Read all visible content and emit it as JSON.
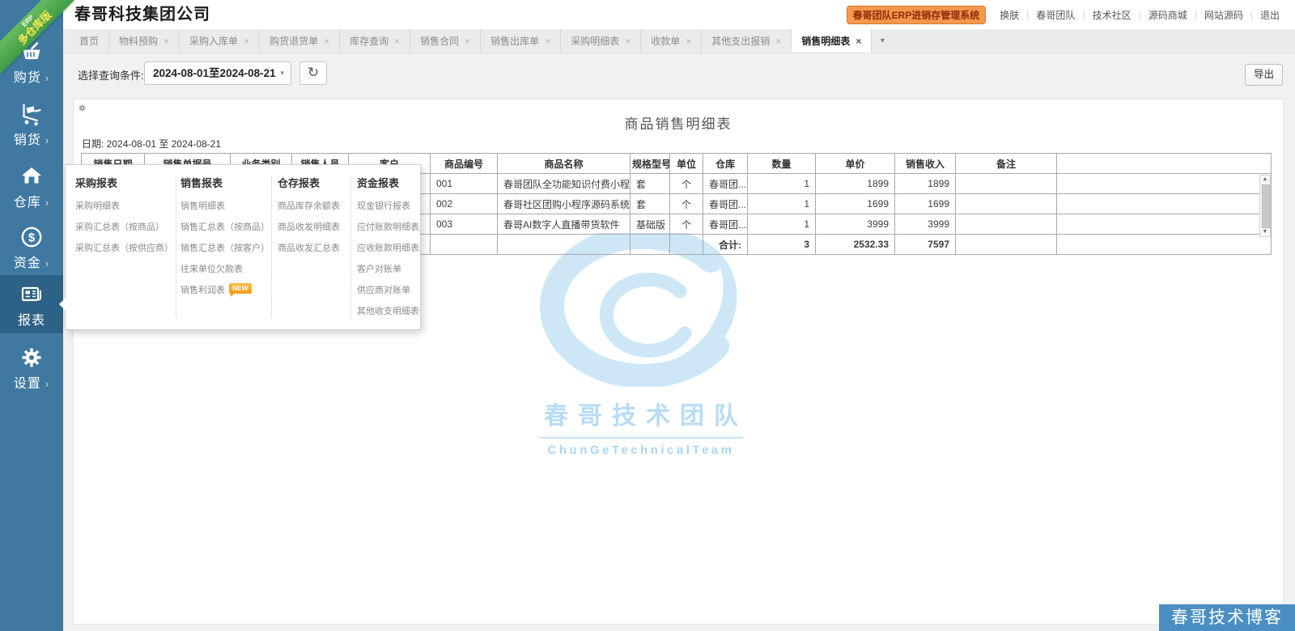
{
  "colors": {
    "sidebar": "#3f79a2",
    "sidebar_active": "#2d6286",
    "ribbon_green": "#4aa74d",
    "ribbon_text_yellow": "#ffe94e",
    "badge_orange_bg": "#f2994d",
    "badge_orange_text": "#8f2c0b",
    "watermark_blue": "#cde7f7",
    "footer_blue": "#4a8fc2",
    "new_badge_orange": "#f59d16"
  },
  "ribbon": {
    "line1": "ERP",
    "line2": "多仓库版"
  },
  "header": {
    "company": "春哥科技集团公司",
    "badge": "春哥团队ERP进销存管理系统",
    "links": [
      "换肤",
      "春哥团队",
      "技术社区",
      "源码商城",
      "网站源码",
      "退出"
    ]
  },
  "sidebar": {
    "items": [
      {
        "key": "purchase",
        "label": "购货",
        "icon": "basket-icon",
        "chevron": "›",
        "active": false
      },
      {
        "key": "sales",
        "label": "销货",
        "icon": "trolley-icon",
        "chevron": "›",
        "active": false
      },
      {
        "key": "warehouse",
        "label": "仓库",
        "icon": "warehouse-icon",
        "chevron": "›",
        "active": false
      },
      {
        "key": "funds",
        "label": "资金",
        "icon": "money-icon",
        "chevron": "›",
        "active": false
      },
      {
        "key": "reports",
        "label": "报表",
        "icon": "report-icon",
        "chevron": "",
        "active": true
      },
      {
        "key": "settings",
        "label": "设置",
        "icon": "gear-icon",
        "chevron": "›",
        "active": false
      }
    ]
  },
  "tabs": [
    {
      "label": "首页",
      "closable": false,
      "active": false
    },
    {
      "label": "物料预购",
      "closable": true,
      "active": false
    },
    {
      "label": "采购入库单",
      "closable": true,
      "active": false
    },
    {
      "label": "购货退货单",
      "closable": true,
      "active": false
    },
    {
      "label": "库存查询",
      "closable": true,
      "active": false
    },
    {
      "label": "销售合同",
      "closable": true,
      "active": false
    },
    {
      "label": "销售出库单",
      "closable": true,
      "active": false
    },
    {
      "label": "采购明细表",
      "closable": true,
      "active": false
    },
    {
      "label": "收款单",
      "closable": true,
      "active": false
    },
    {
      "label": "其他支出报销",
      "closable": true,
      "active": false
    },
    {
      "label": "销售明细表",
      "closable": true,
      "active": true
    }
  ],
  "toolbar": {
    "query_label": "选择查询条件:",
    "date_range": "2024-08-01至2024-08-21",
    "export_label": "导出"
  },
  "report": {
    "title": "商品销售明细表",
    "date_line": "日期: 2024-08-01 至 2024-08-21"
  },
  "table": {
    "headers": [
      "销售日期",
      "销售单据号",
      "业务类别",
      "销售人员",
      "客户",
      "商品编号",
      "商品名称",
      "规格型号",
      "单位",
      "仓库",
      "数量",
      "单价",
      "销售收入",
      "备注",
      ""
    ],
    "rows": [
      [
        "",
        "",
        "",
        "",
        "",
        "001",
        "春哥团队全功能知识付费小程序源...",
        "套",
        "个",
        "春哥团...",
        "1",
        "1899",
        "1899",
        "",
        ""
      ],
      [
        "",
        "",
        "",
        "",
        "",
        "002",
        "春哥社区团购小程序源码系统至尊版",
        "套",
        "个",
        "春哥团...",
        "1",
        "1699",
        "1699",
        "",
        ""
      ],
      [
        "",
        "",
        "",
        "",
        "",
        "003",
        "春哥AI数字人直播带货软件",
        "基础版",
        "个",
        "春哥团...",
        "1",
        "3999",
        "3999",
        "",
        ""
      ]
    ],
    "total_row": [
      "",
      "",
      "",
      "",
      "",
      "",
      "",
      "",
      "",
      "合计:",
      "3",
      "2532.33",
      "7597",
      "",
      ""
    ]
  },
  "menu": {
    "columns": [
      {
        "title": "采购报表",
        "items": [
          {
            "label": "采购明细表"
          },
          {
            "label": "采购汇总表（按商品）"
          },
          {
            "label": "采购汇总表（按供应商）"
          }
        ]
      },
      {
        "title": "销售报表",
        "items": [
          {
            "label": "销售明细表"
          },
          {
            "label": "销售汇总表（按商品）"
          },
          {
            "label": "销售汇总表（按客户）"
          },
          {
            "label": "往来单位欠款表"
          },
          {
            "label": "销售利润表",
            "badge": "NEW"
          }
        ]
      },
      {
        "title": "仓存报表",
        "items": [
          {
            "label": "商品库存余额表"
          },
          {
            "label": "商品收发明细表"
          },
          {
            "label": "商品收发汇总表"
          }
        ]
      },
      {
        "title": "资金报表",
        "items": [
          {
            "label": "现金银行报表"
          },
          {
            "label": "应付账款明细表"
          },
          {
            "label": "应收账款明细表"
          },
          {
            "label": "客户对账单"
          },
          {
            "label": "供应商对账单"
          },
          {
            "label": "其他收支明细表"
          }
        ]
      }
    ]
  },
  "watermark": {
    "cn": "春哥技术团队",
    "en": "ChunGeTechnicalTeam"
  },
  "footer": {
    "badge": "春哥技术博客"
  },
  "icons": {
    "refresh": "↻",
    "caret_down": "▾",
    "close": "×",
    "chevron": "›",
    "scroll_up": "▲",
    "scroll_down": "▼"
  }
}
